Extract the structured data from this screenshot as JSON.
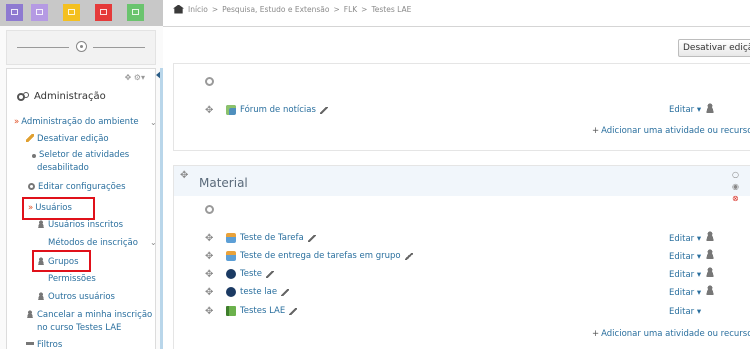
{
  "topbar": {
    "color_buttons": [
      {
        "name": "theme-button-1",
        "color": "#8e7ad1"
      },
      {
        "name": "theme-button-2",
        "color": "#b59ae3"
      },
      {
        "name": "theme-button-3",
        "color": "#f4c020"
      },
      {
        "name": "theme-button-4",
        "color": "#e53a3a"
      },
      {
        "name": "theme-button-5",
        "color": "#6ac46e"
      }
    ]
  },
  "breadcrumb": {
    "items": [
      "Início",
      ">",
      "Pesquisa, Estudo e Extensão",
      ">",
      "FLK",
      ">",
      "Testes LAE"
    ]
  },
  "admin_block": {
    "title": "Administração",
    "items": [
      {
        "label": "Administração do ambiente"
      },
      {
        "label": "Desativar edição"
      },
      {
        "label": "Seletor de atividades"
      },
      {
        "label": "desabilitado"
      },
      {
        "label": "Editar configurações"
      },
      {
        "label": "Usuários"
      },
      {
        "label": "Usuários inscritos"
      },
      {
        "label": "Métodos de inscrição"
      },
      {
        "label": "Grupos"
      },
      {
        "label": "Permissões"
      },
      {
        "label": "Outros usuários"
      },
      {
        "label": "Cancelar a minha inscrição"
      },
      {
        "label": "no curso Testes LAE"
      },
      {
        "label": "Filtros"
      }
    ]
  },
  "main": {
    "edit_toggle_label": "Desativar edição",
    "section0": {
      "activities": [
        {
          "name": "Fórum de notícias",
          "edit": "Editar"
        }
      ],
      "add_label": "Adicionar uma atividade ou recurso"
    },
    "section1": {
      "title": "Material",
      "activities": [
        {
          "name": "Teste de Tarefa",
          "edit": "Editar"
        },
        {
          "name": "Teste de entrega de tarefas em grupo",
          "edit": "Editar"
        },
        {
          "name": "Teste",
          "edit": "Editar"
        },
        {
          "name": "teste lae",
          "edit": "Editar"
        },
        {
          "name": "Testes LAE",
          "edit": "Editar"
        }
      ],
      "add_label": "Adicionar uma atividade ou recurso"
    }
  },
  "highlight_color": "#e0111a"
}
